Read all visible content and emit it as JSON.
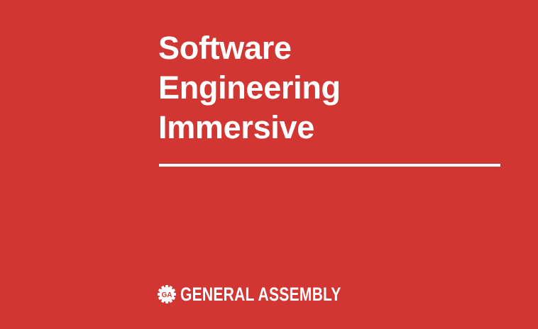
{
  "slide": {
    "title_lines": [
      "Software",
      "Engineering",
      "Immersive"
    ],
    "logo": {
      "icon": "ga-gear-badge",
      "badge_text": "GA",
      "text": "GENERAL ASSEMBLY"
    },
    "colors": {
      "background": "#d23632",
      "foreground": "#ffffff"
    }
  }
}
